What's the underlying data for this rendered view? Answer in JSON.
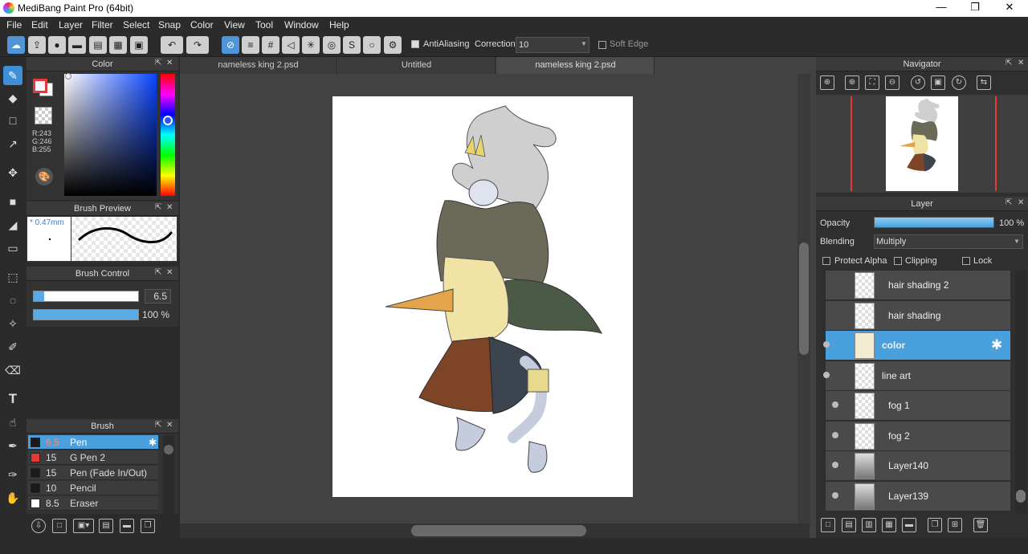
{
  "app": {
    "title": "MediBang Paint Pro (64bit)"
  },
  "window_controls": {
    "minimize": "—",
    "maximize": "❐",
    "close": "✕"
  },
  "menus": [
    "File",
    "Edit",
    "Layer",
    "Filter",
    "Select",
    "Snap",
    "Color",
    "View",
    "Tool",
    "Window",
    "Help"
  ],
  "toolbar": {
    "antialiasing_label": "AntiAliasing",
    "correction_label": "Correction",
    "correction_value": "10",
    "soft_edge_label": "Soft Edge",
    "antialiasing_checked": true,
    "soft_edge_checked": false
  },
  "color_panel": {
    "title": "Color",
    "r": "R:243",
    "g": "G:246",
    "b": "B:255",
    "primary_color": "#f3f6ff",
    "secondary_color": "#ffffff"
  },
  "brush_preview": {
    "title": "Brush Preview",
    "size_label": "* 0.47mm"
  },
  "brush_control": {
    "title": "Brush Control",
    "size_value": "6.5",
    "opacity_value": "100 %",
    "size_fraction": 0.1,
    "opacity_fraction": 1.0
  },
  "brush_panel": {
    "title": "Brush",
    "brushes": [
      {
        "size": "6.5",
        "name": "Pen",
        "color": "#1a1a1a",
        "selected": true
      },
      {
        "size": "15",
        "name": "G Pen 2",
        "color": "#e53935",
        "selected": false
      },
      {
        "size": "15",
        "name": "Pen (Fade In/Out)",
        "color": "#1a1a1a",
        "selected": false
      },
      {
        "size": "10",
        "name": "Pencil",
        "color": "#1a1a1a",
        "selected": false
      },
      {
        "size": "8.5",
        "name": "Eraser",
        "color": "#ffffff",
        "selected": false
      }
    ]
  },
  "tabs": [
    {
      "label": "nameless king 2.psd",
      "active": false
    },
    {
      "label": "Untitled",
      "active": false
    },
    {
      "label": "nameless king 2.psd",
      "active": true
    }
  ],
  "navigator": {
    "title": "Navigator"
  },
  "layer_panel": {
    "title": "Layer",
    "opacity_label": "Opacity",
    "opacity_value": "100 %",
    "blending_label": "Blending",
    "blending_value": "Multiply",
    "protect_alpha_label": "Protect Alpha",
    "clipping_label": "Clipping",
    "lock_label": "Lock",
    "layers": [
      {
        "name": "hair shading 2",
        "selected": false
      },
      {
        "name": "hair shading",
        "selected": false
      },
      {
        "name": "color",
        "selected": true
      },
      {
        "name": "line art",
        "selected": false
      },
      {
        "name": "fog 1",
        "selected": false
      },
      {
        "name": "fog 2",
        "selected": false
      },
      {
        "name": "Layer140",
        "selected": false
      },
      {
        "name": "Layer139",
        "selected": false
      }
    ]
  },
  "colors": {
    "accent": "#4aa0dc"
  }
}
